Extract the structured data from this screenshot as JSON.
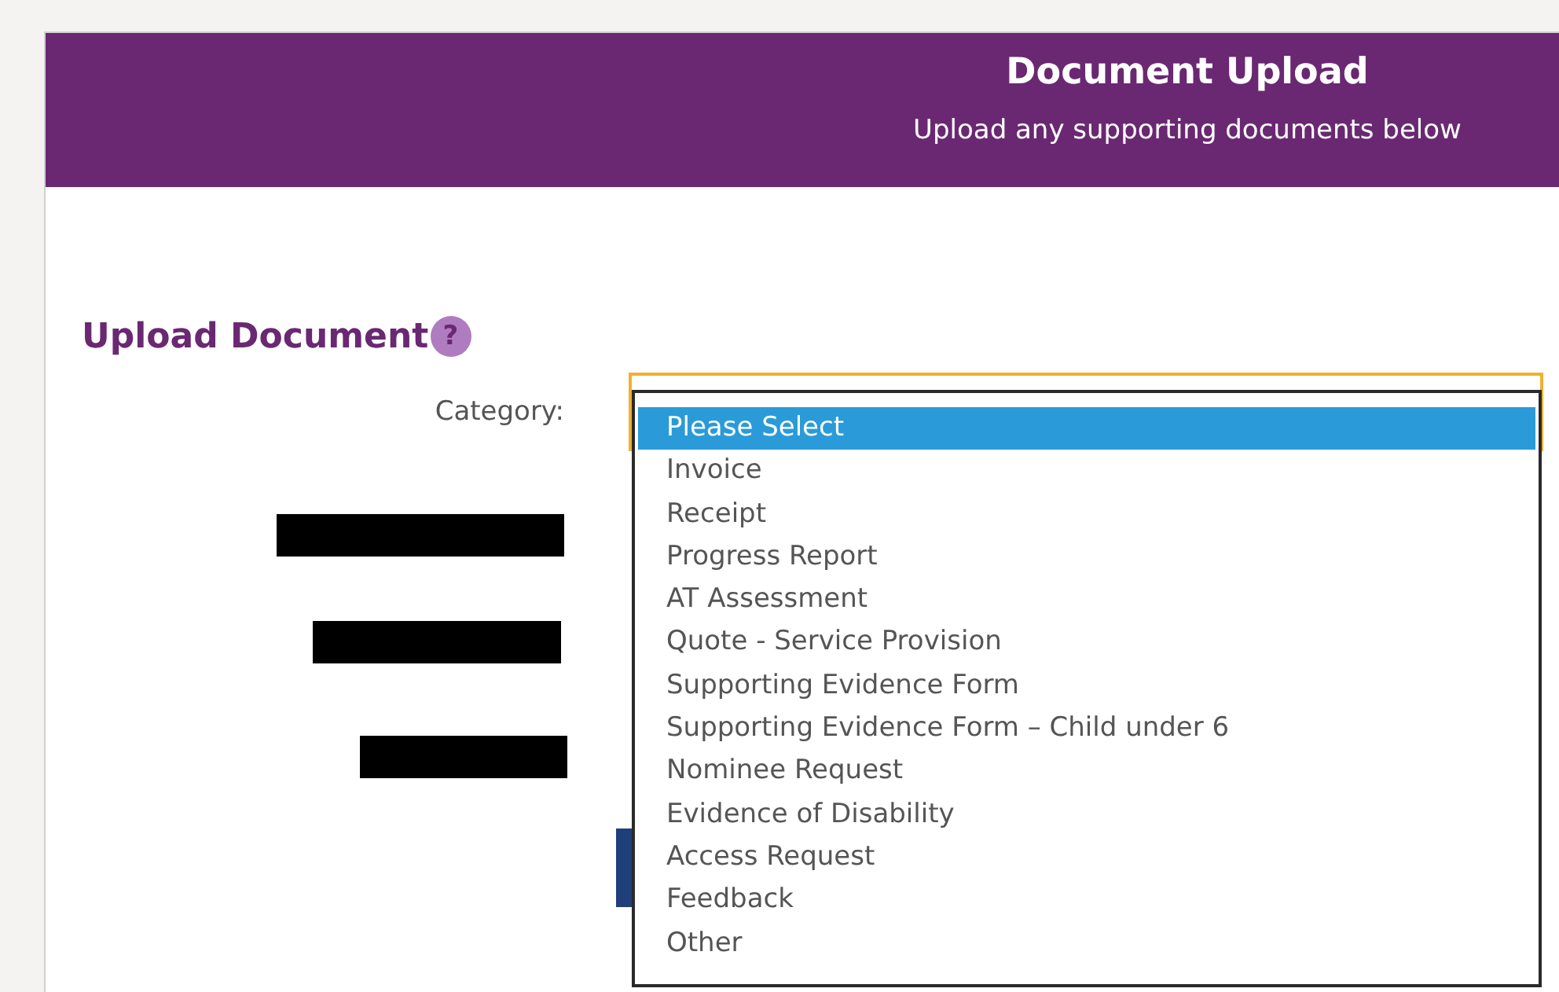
{
  "header": {
    "title": "Document Upload",
    "subtitle": "Upload any supporting documents below"
  },
  "section": {
    "title": "Upload Document",
    "help_icon": "?"
  },
  "category": {
    "label": "Category:",
    "expanded": true,
    "options": [
      {
        "label": "Please Select",
        "selected": true
      },
      {
        "label": "Invoice",
        "selected": false
      },
      {
        "label": "Receipt",
        "selected": false
      },
      {
        "label": "Progress Report",
        "selected": false
      },
      {
        "label": "AT Assessment",
        "selected": false
      },
      {
        "label": "Quote - Service Provision",
        "selected": false
      },
      {
        "label": "Supporting Evidence Form",
        "selected": false
      },
      {
        "label": "Supporting Evidence Form – Child under 6",
        "selected": false
      },
      {
        "label": "Nominee Request",
        "selected": false
      },
      {
        "label": "Evidence of Disability",
        "selected": false
      },
      {
        "label": "Access Request",
        "selected": false
      },
      {
        "label": "Feedback",
        "selected": false
      },
      {
        "label": "Other",
        "selected": false
      }
    ]
  },
  "hidden_fields": [
    {
      "kind": "redacted"
    },
    {
      "kind": "redacted"
    },
    {
      "kind": "redacted"
    },
    {
      "kind": "button"
    }
  ]
}
